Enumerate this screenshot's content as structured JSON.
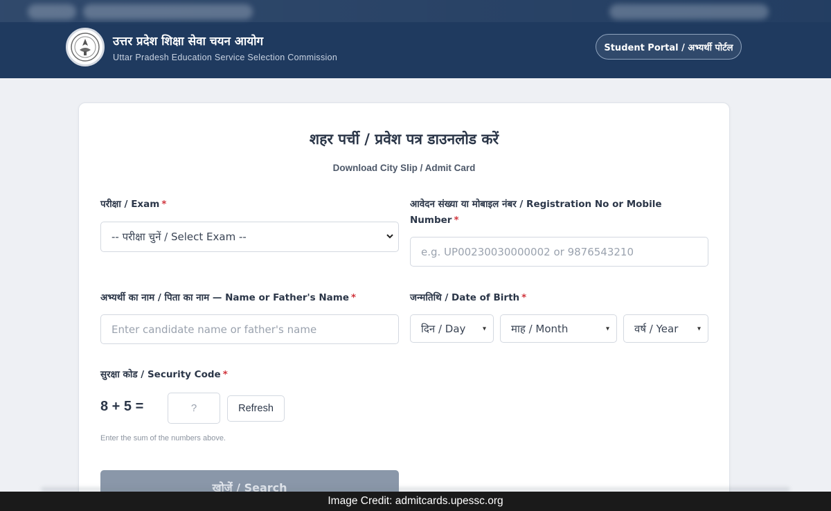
{
  "header": {
    "org_name_hi": "उत्तर प्रदेश शिक्षा सेवा चयन आयोग",
    "org_name_en": "Uttar Pradesh Education Service Selection Commission",
    "logo_icon": "state-emblem-icon",
    "portal_button": "Student Portal / अभ्यर्थी पोर्टल",
    "bg_color": "#1f3a5f"
  },
  "form": {
    "title": "शहर पर्ची / प्रवेश पत्र डाउनलोड करें",
    "subtitle": "Download City Slip / Admit Card",
    "exam": {
      "label": "परीक्षा / Exam",
      "required": "*",
      "selected": "-- परीक्षा चुनें / Select Exam --"
    },
    "registration": {
      "label": "आवेदन संख्या या मोबाइल नंबर / Registration No or Mobile Number",
      "required": "*",
      "placeholder": "e.g. UP00230030000002 or 9876543210"
    },
    "name": {
      "label": "अभ्यर्थी का नाम / पिता का नाम — Name or Father's Name",
      "required": "*",
      "placeholder": "Enter candidate name or father's name"
    },
    "dob": {
      "label": "जन्मतिथि / Date of Birth",
      "required": "*",
      "day": "दिन / Day",
      "month": "माह / Month",
      "year": "वर्ष / Year"
    },
    "security": {
      "label": "सुरक्षा कोड / Security Code",
      "required": "*",
      "question": "8 + 5 =",
      "placeholder": "?",
      "refresh": "Refresh",
      "hint": "Enter the sum of the numbers above."
    },
    "search_button": "खोजें / Search"
  },
  "credit": "Image Credit: admitcards.upessc.org"
}
